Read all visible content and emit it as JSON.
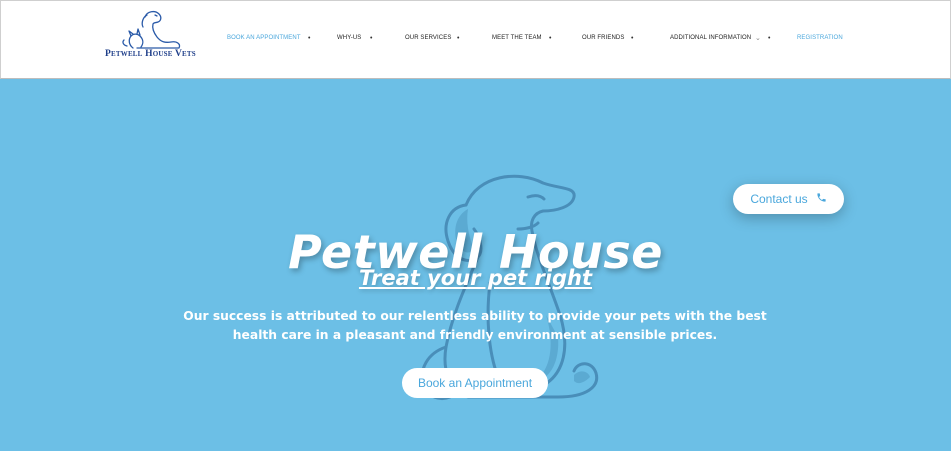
{
  "brand": {
    "name": "Petwell House Vets",
    "logo_icon": "dog-and-cat-logo"
  },
  "nav": {
    "items": [
      {
        "label": "Book an Appointment",
        "dot": "•"
      },
      {
        "label": "Why-us",
        "dot": "•"
      },
      {
        "label": "Our Services",
        "dot": "•"
      },
      {
        "label": "Meet the Team",
        "dot": "•"
      },
      {
        "label": "Our Friends",
        "dot": "•"
      },
      {
        "label": "Additional Information",
        "chevron": "⌄",
        "dot": "•"
      },
      {
        "label": "Registration"
      }
    ],
    "active_index": 0
  },
  "hero": {
    "title": "Petwell House",
    "subtitle": "Treat your pet right",
    "text": "Our success is attributed to our relentless ability to provide your pets with the best health care in a pleasant and friendly environment at sensible prices.",
    "cta_label": "Book an Appointment",
    "contact_label": "Contact us",
    "contact_icon": "phone-icon",
    "background_image": "dog-outline"
  },
  "colors": {
    "hero_bg": "#6cbfe6",
    "accent": "#4aa7dc",
    "brand_text": "#1f3f8a"
  }
}
